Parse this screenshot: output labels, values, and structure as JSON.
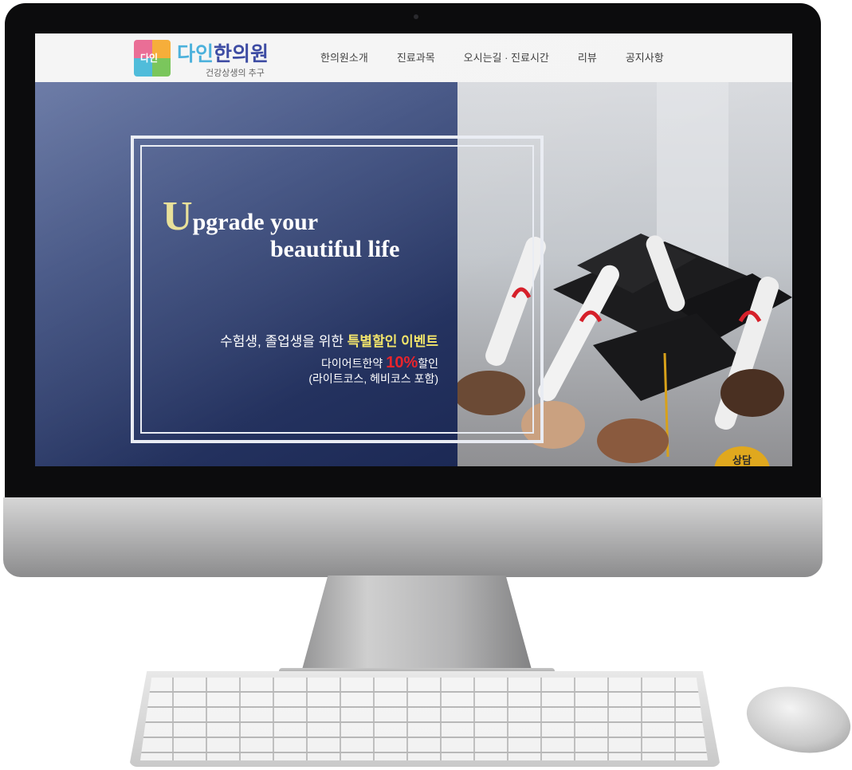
{
  "header": {
    "logo_mark_text": "다인",
    "brand_name_accent": "다인",
    "brand_name_main": "한의원",
    "tagline": "건강상생의 추구"
  },
  "nav": {
    "items": [
      "한의원소개",
      "진료과목",
      "오시는길 · 진료시간",
      "리뷰",
      "공지사항"
    ]
  },
  "hero": {
    "headline_initial": "U",
    "headline_line1_rest": "pgrade your",
    "headline_line2": "beautiful life",
    "event_prefix": "수험생, 졸업생을 위한 ",
    "event_highlight": "특별할인 이벤트",
    "offer_prefix": "다이어트한약 ",
    "offer_percent": "10%",
    "offer_suffix": "할인",
    "offer_note": "(라이트코스, 헤비코스 포함)"
  },
  "consult_button": {
    "label": "상담"
  },
  "colors": {
    "brand_blue": "#2a3a9a",
    "brand_cyan": "#38a9d8",
    "headline_gold": "#e7df93",
    "event_yellow": "#f2e46a",
    "discount_red": "#e8242c",
    "consult_orange": "#e0a81e"
  }
}
